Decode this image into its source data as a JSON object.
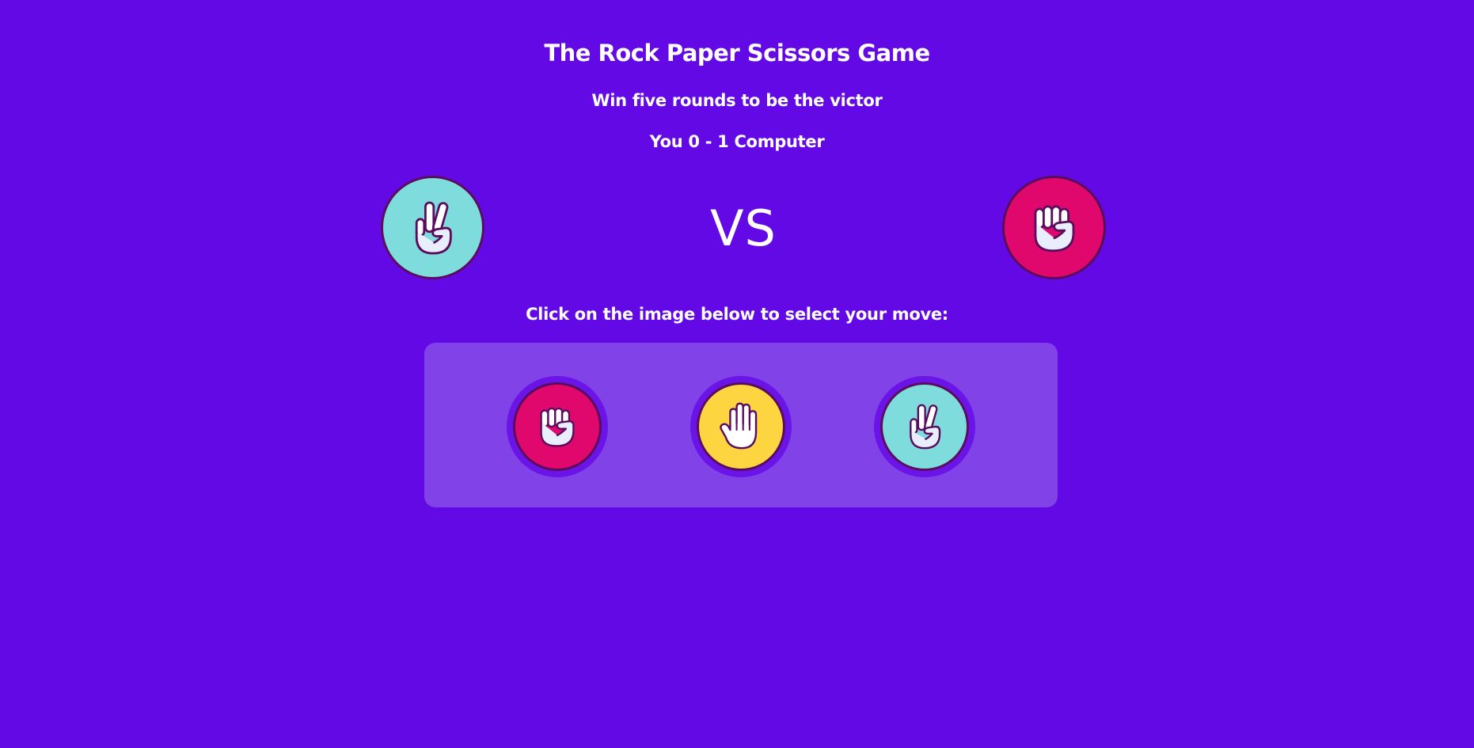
{
  "game": {
    "title": "The Rock Paper Scissors Game",
    "subtitle": "Win five rounds to be the victor",
    "score": "You 0 - 1 Computer",
    "vs_label": "VS",
    "instruction": "Click on the image below to select your move:"
  },
  "arena": {
    "player_move": "scissors",
    "computer_move": "rock"
  },
  "choices": [
    {
      "move": "rock",
      "icon": "rock-fist-icon",
      "color": "#e0086c"
    },
    {
      "move": "paper",
      "icon": "paper-hand-icon",
      "color": "#fdd540"
    },
    {
      "move": "scissors",
      "icon": "scissors-fingers-icon",
      "color": "#7fdcdc"
    }
  ],
  "colors": {
    "background": "#6209e6",
    "panel": "#8142e8",
    "rock": "#e0086c",
    "paper": "#fdd540",
    "scissors": "#7fdcdc",
    "outline": "#5b0c5e",
    "hand_fill": "#e8eefc"
  }
}
